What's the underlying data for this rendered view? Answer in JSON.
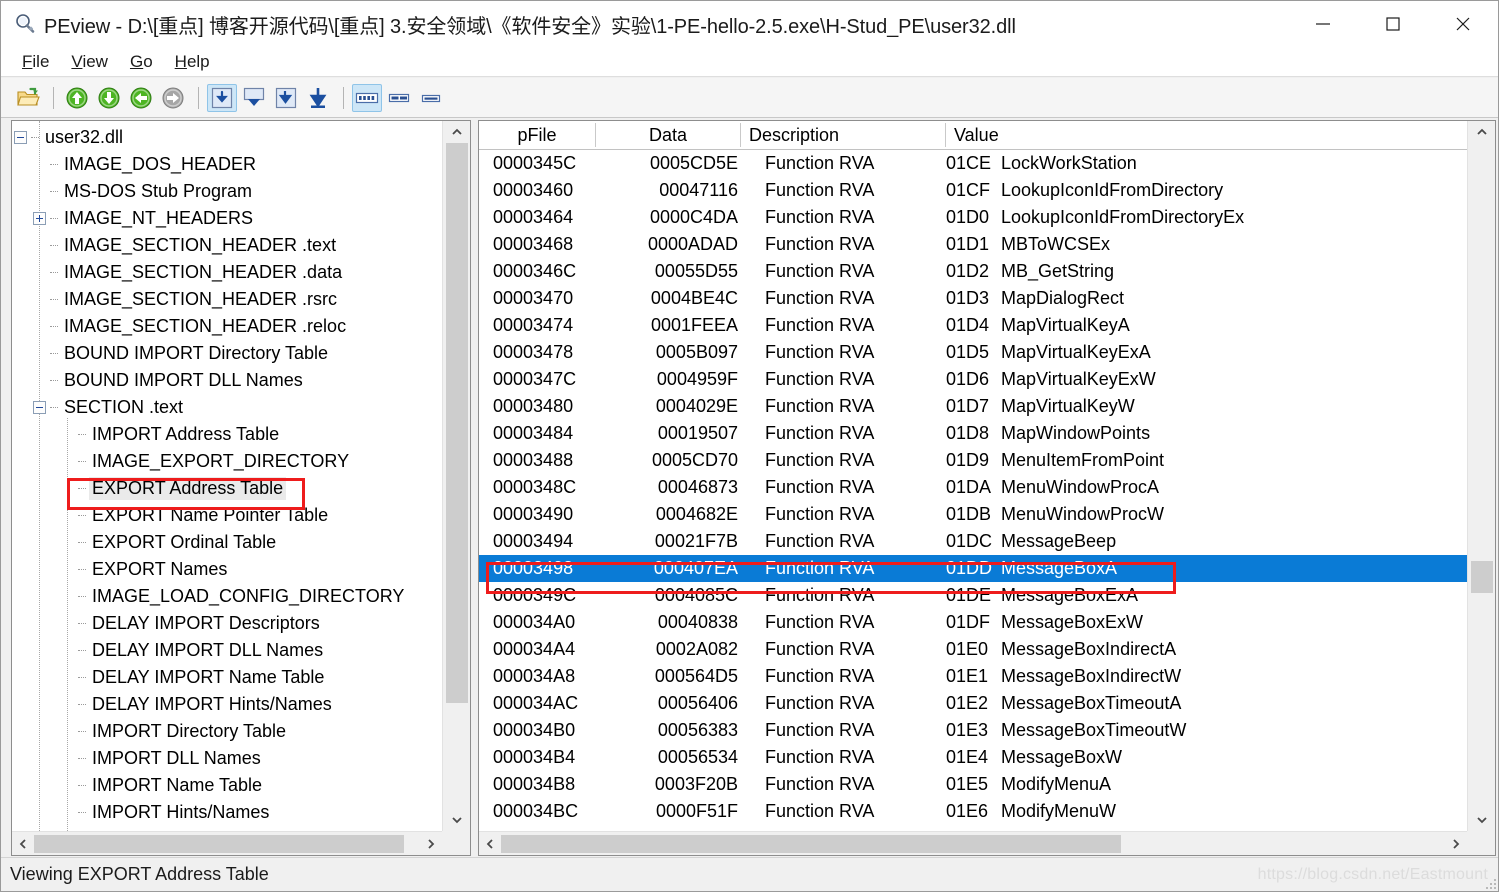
{
  "window": {
    "title": "PEview - D:\\[重点] 博客开源代码\\[重点] 3.安全领域\\《软件安全》实验\\1-PE-hello-2.5.exe\\H-Stud_PE\\user32.dll",
    "app_icon": "magnifier-icon",
    "minimize_label": "—",
    "maximize_label": "□",
    "close_label": "✕"
  },
  "menu": {
    "items": [
      {
        "label": "File",
        "mnemonic": "F"
      },
      {
        "label": "View",
        "mnemonic": "V"
      },
      {
        "label": "Go",
        "mnemonic": "G"
      },
      {
        "label": "Help",
        "mnemonic": "H"
      }
    ]
  },
  "toolbar": {
    "buttons": [
      {
        "name": "open-file-icon",
        "kind": "open",
        "active": false
      },
      {
        "name": "sep",
        "kind": "sep"
      },
      {
        "name": "go-up-icon",
        "kind": "arrow-up-green",
        "active": false
      },
      {
        "name": "go-down-icon",
        "kind": "arrow-down-green",
        "active": false
      },
      {
        "name": "go-back-icon",
        "kind": "arrow-left-green",
        "active": false
      },
      {
        "name": "go-forward-icon",
        "kind": "arrow-right-gray",
        "active": false
      },
      {
        "name": "sep",
        "kind": "sep"
      },
      {
        "name": "view-hex-icon",
        "kind": "box-down-1",
        "active": true
      },
      {
        "name": "view-text-icon",
        "kind": "box-down-2",
        "active": false
      },
      {
        "name": "view-struct-icon",
        "kind": "box-down-3",
        "active": false
      },
      {
        "name": "view-raw-icon",
        "kind": "box-down-4",
        "active": false
      },
      {
        "name": "sep",
        "kind": "sep"
      },
      {
        "name": "columns-many-icon",
        "kind": "cols-4",
        "active": true
      },
      {
        "name": "columns-two-icon",
        "kind": "cols-2",
        "active": false
      },
      {
        "name": "columns-one-icon",
        "kind": "cols-1",
        "active": false
      }
    ]
  },
  "tree": {
    "root_label": "user32.dll",
    "items": [
      {
        "label": "user32.dll",
        "depth": 0,
        "toggle": "minus",
        "highlighted": false
      },
      {
        "label": "IMAGE_DOS_HEADER",
        "depth": 1,
        "toggle": "leaf",
        "highlighted": false
      },
      {
        "label": "MS-DOS Stub Program",
        "depth": 1,
        "toggle": "leaf",
        "highlighted": false
      },
      {
        "label": "IMAGE_NT_HEADERS",
        "depth": 1,
        "toggle": "plus",
        "highlighted": false
      },
      {
        "label": "IMAGE_SECTION_HEADER .text",
        "depth": 1,
        "toggle": "leaf",
        "highlighted": false
      },
      {
        "label": "IMAGE_SECTION_HEADER .data",
        "depth": 1,
        "toggle": "leaf",
        "highlighted": false
      },
      {
        "label": "IMAGE_SECTION_HEADER .rsrc",
        "depth": 1,
        "toggle": "leaf",
        "highlighted": false
      },
      {
        "label": "IMAGE_SECTION_HEADER .reloc",
        "depth": 1,
        "toggle": "leaf",
        "highlighted": false
      },
      {
        "label": "BOUND IMPORT Directory Table",
        "depth": 1,
        "toggle": "leaf",
        "highlighted": false
      },
      {
        "label": "BOUND IMPORT DLL Names",
        "depth": 1,
        "toggle": "leaf",
        "highlighted": false
      },
      {
        "label": "SECTION .text",
        "depth": 1,
        "toggle": "minus",
        "highlighted": false
      },
      {
        "label": "IMPORT Address Table",
        "depth": 2,
        "toggle": "leaf",
        "highlighted": false
      },
      {
        "label": "IMAGE_EXPORT_DIRECTORY",
        "depth": 2,
        "toggle": "leaf",
        "highlighted": false
      },
      {
        "label": "EXPORT Address Table",
        "depth": 2,
        "toggle": "leaf",
        "highlighted": true
      },
      {
        "label": "EXPORT Name Pointer Table",
        "depth": 2,
        "toggle": "leaf",
        "highlighted": false
      },
      {
        "label": "EXPORT Ordinal Table",
        "depth": 2,
        "toggle": "leaf",
        "highlighted": false
      },
      {
        "label": "EXPORT Names",
        "depth": 2,
        "toggle": "leaf",
        "highlighted": false
      },
      {
        "label": "IMAGE_LOAD_CONFIG_DIRECTORY",
        "depth": 2,
        "toggle": "leaf",
        "highlighted": false
      },
      {
        "label": "DELAY IMPORT Descriptors",
        "depth": 2,
        "toggle": "leaf",
        "highlighted": false
      },
      {
        "label": "DELAY IMPORT DLL Names",
        "depth": 2,
        "toggle": "leaf",
        "highlighted": false
      },
      {
        "label": "DELAY IMPORT Name Table",
        "depth": 2,
        "toggle": "leaf",
        "highlighted": false
      },
      {
        "label": "DELAY IMPORT Hints/Names",
        "depth": 2,
        "toggle": "leaf",
        "highlighted": false
      },
      {
        "label": "IMPORT Directory Table",
        "depth": 2,
        "toggle": "leaf",
        "highlighted": false
      },
      {
        "label": "IMPORT DLL Names",
        "depth": 2,
        "toggle": "leaf",
        "highlighted": false
      },
      {
        "label": "IMPORT Name Table",
        "depth": 2,
        "toggle": "leaf",
        "highlighted": false
      },
      {
        "label": "IMPORT Hints/Names",
        "depth": 2,
        "toggle": "leaf",
        "highlighted": false
      }
    ]
  },
  "table": {
    "columns": [
      "pFile",
      "Data",
      "Description",
      "Value"
    ],
    "rows": [
      {
        "pFile": "0000345C",
        "data": "0005CD5E",
        "description": "Function RVA",
        "ordinal": "01CE",
        "name": "LockWorkStation",
        "selected": false
      },
      {
        "pFile": "00003460",
        "data": "00047116",
        "description": "Function RVA",
        "ordinal": "01CF",
        "name": "LookupIconIdFromDirectory",
        "selected": false
      },
      {
        "pFile": "00003464",
        "data": "0000C4DA",
        "description": "Function RVA",
        "ordinal": "01D0",
        "name": "LookupIconIdFromDirectoryEx",
        "selected": false
      },
      {
        "pFile": "00003468",
        "data": "0000ADAD",
        "description": "Function RVA",
        "ordinal": "01D1",
        "name": "MBToWCSEx",
        "selected": false
      },
      {
        "pFile": "0000346C",
        "data": "00055D55",
        "description": "Function RVA",
        "ordinal": "01D2",
        "name": "MB_GetString",
        "selected": false
      },
      {
        "pFile": "00003470",
        "data": "0004BE4C",
        "description": "Function RVA",
        "ordinal": "01D3",
        "name": "MapDialogRect",
        "selected": false
      },
      {
        "pFile": "00003474",
        "data": "0001FEEA",
        "description": "Function RVA",
        "ordinal": "01D4",
        "name": "MapVirtualKeyA",
        "selected": false
      },
      {
        "pFile": "00003478",
        "data": "0005B097",
        "description": "Function RVA",
        "ordinal": "01D5",
        "name": "MapVirtualKeyExA",
        "selected": false
      },
      {
        "pFile": "0000347C",
        "data": "0004959F",
        "description": "Function RVA",
        "ordinal": "01D6",
        "name": "MapVirtualKeyExW",
        "selected": false
      },
      {
        "pFile": "00003480",
        "data": "0004029E",
        "description": "Function RVA",
        "ordinal": "01D7",
        "name": "MapVirtualKeyW",
        "selected": false
      },
      {
        "pFile": "00003484",
        "data": "00019507",
        "description": "Function RVA",
        "ordinal": "01D8",
        "name": "MapWindowPoints",
        "selected": false
      },
      {
        "pFile": "00003488",
        "data": "0005CD70",
        "description": "Function RVA",
        "ordinal": "01D9",
        "name": "MenuItemFromPoint",
        "selected": false
      },
      {
        "pFile": "0000348C",
        "data": "00046873",
        "description": "Function RVA",
        "ordinal": "01DA",
        "name": "MenuWindowProcA",
        "selected": false
      },
      {
        "pFile": "00003490",
        "data": "0004682E",
        "description": "Function RVA",
        "ordinal": "01DB",
        "name": "MenuWindowProcW",
        "selected": false
      },
      {
        "pFile": "00003494",
        "data": "00021F7B",
        "description": "Function RVA",
        "ordinal": "01DC",
        "name": "MessageBeep",
        "selected": false
      },
      {
        "pFile": "00003498",
        "data": "000407EA",
        "description": "Function RVA",
        "ordinal": "01DD",
        "name": "MessageBoxA",
        "selected": true
      },
      {
        "pFile": "0000349C",
        "data": "0004085C",
        "description": "Function RVA",
        "ordinal": "01DE",
        "name": "MessageBoxExA",
        "selected": false
      },
      {
        "pFile": "000034A0",
        "data": "00040838",
        "description": "Function RVA",
        "ordinal": "01DF",
        "name": "MessageBoxExW",
        "selected": false
      },
      {
        "pFile": "000034A4",
        "data": "0002A082",
        "description": "Function RVA",
        "ordinal": "01E0",
        "name": "MessageBoxIndirectA",
        "selected": false
      },
      {
        "pFile": "000034A8",
        "data": "000564D5",
        "description": "Function RVA",
        "ordinal": "01E1",
        "name": "MessageBoxIndirectW",
        "selected": false
      },
      {
        "pFile": "000034AC",
        "data": "00056406",
        "description": "Function RVA",
        "ordinal": "01E2",
        "name": "MessageBoxTimeoutA",
        "selected": false
      },
      {
        "pFile": "000034B0",
        "data": "00056383",
        "description": "Function RVA",
        "ordinal": "01E3",
        "name": "MessageBoxTimeoutW",
        "selected": false
      },
      {
        "pFile": "000034B4",
        "data": "00056534",
        "description": "Function RVA",
        "ordinal": "01E4",
        "name": "MessageBoxW",
        "selected": false
      },
      {
        "pFile": "000034B8",
        "data": "0003F20B",
        "description": "Function RVA",
        "ordinal": "01E5",
        "name": "ModifyMenuA",
        "selected": false
      },
      {
        "pFile": "000034BC",
        "data": "0000F51F",
        "description": "Function RVA",
        "ordinal": "01E6",
        "name": "ModifyMenuW",
        "selected": false
      }
    ]
  },
  "statusbar": {
    "text": "Viewing EXPORT Address Table",
    "watermark": "https://blog.csdn.net/Eastmount"
  },
  "colors": {
    "selection_blue": "#0a7bd6",
    "annotation_red": "#ee1c1c",
    "toolbar_active": "#cde6f7",
    "scrollbar_thumb": "#cdcdcd"
  }
}
